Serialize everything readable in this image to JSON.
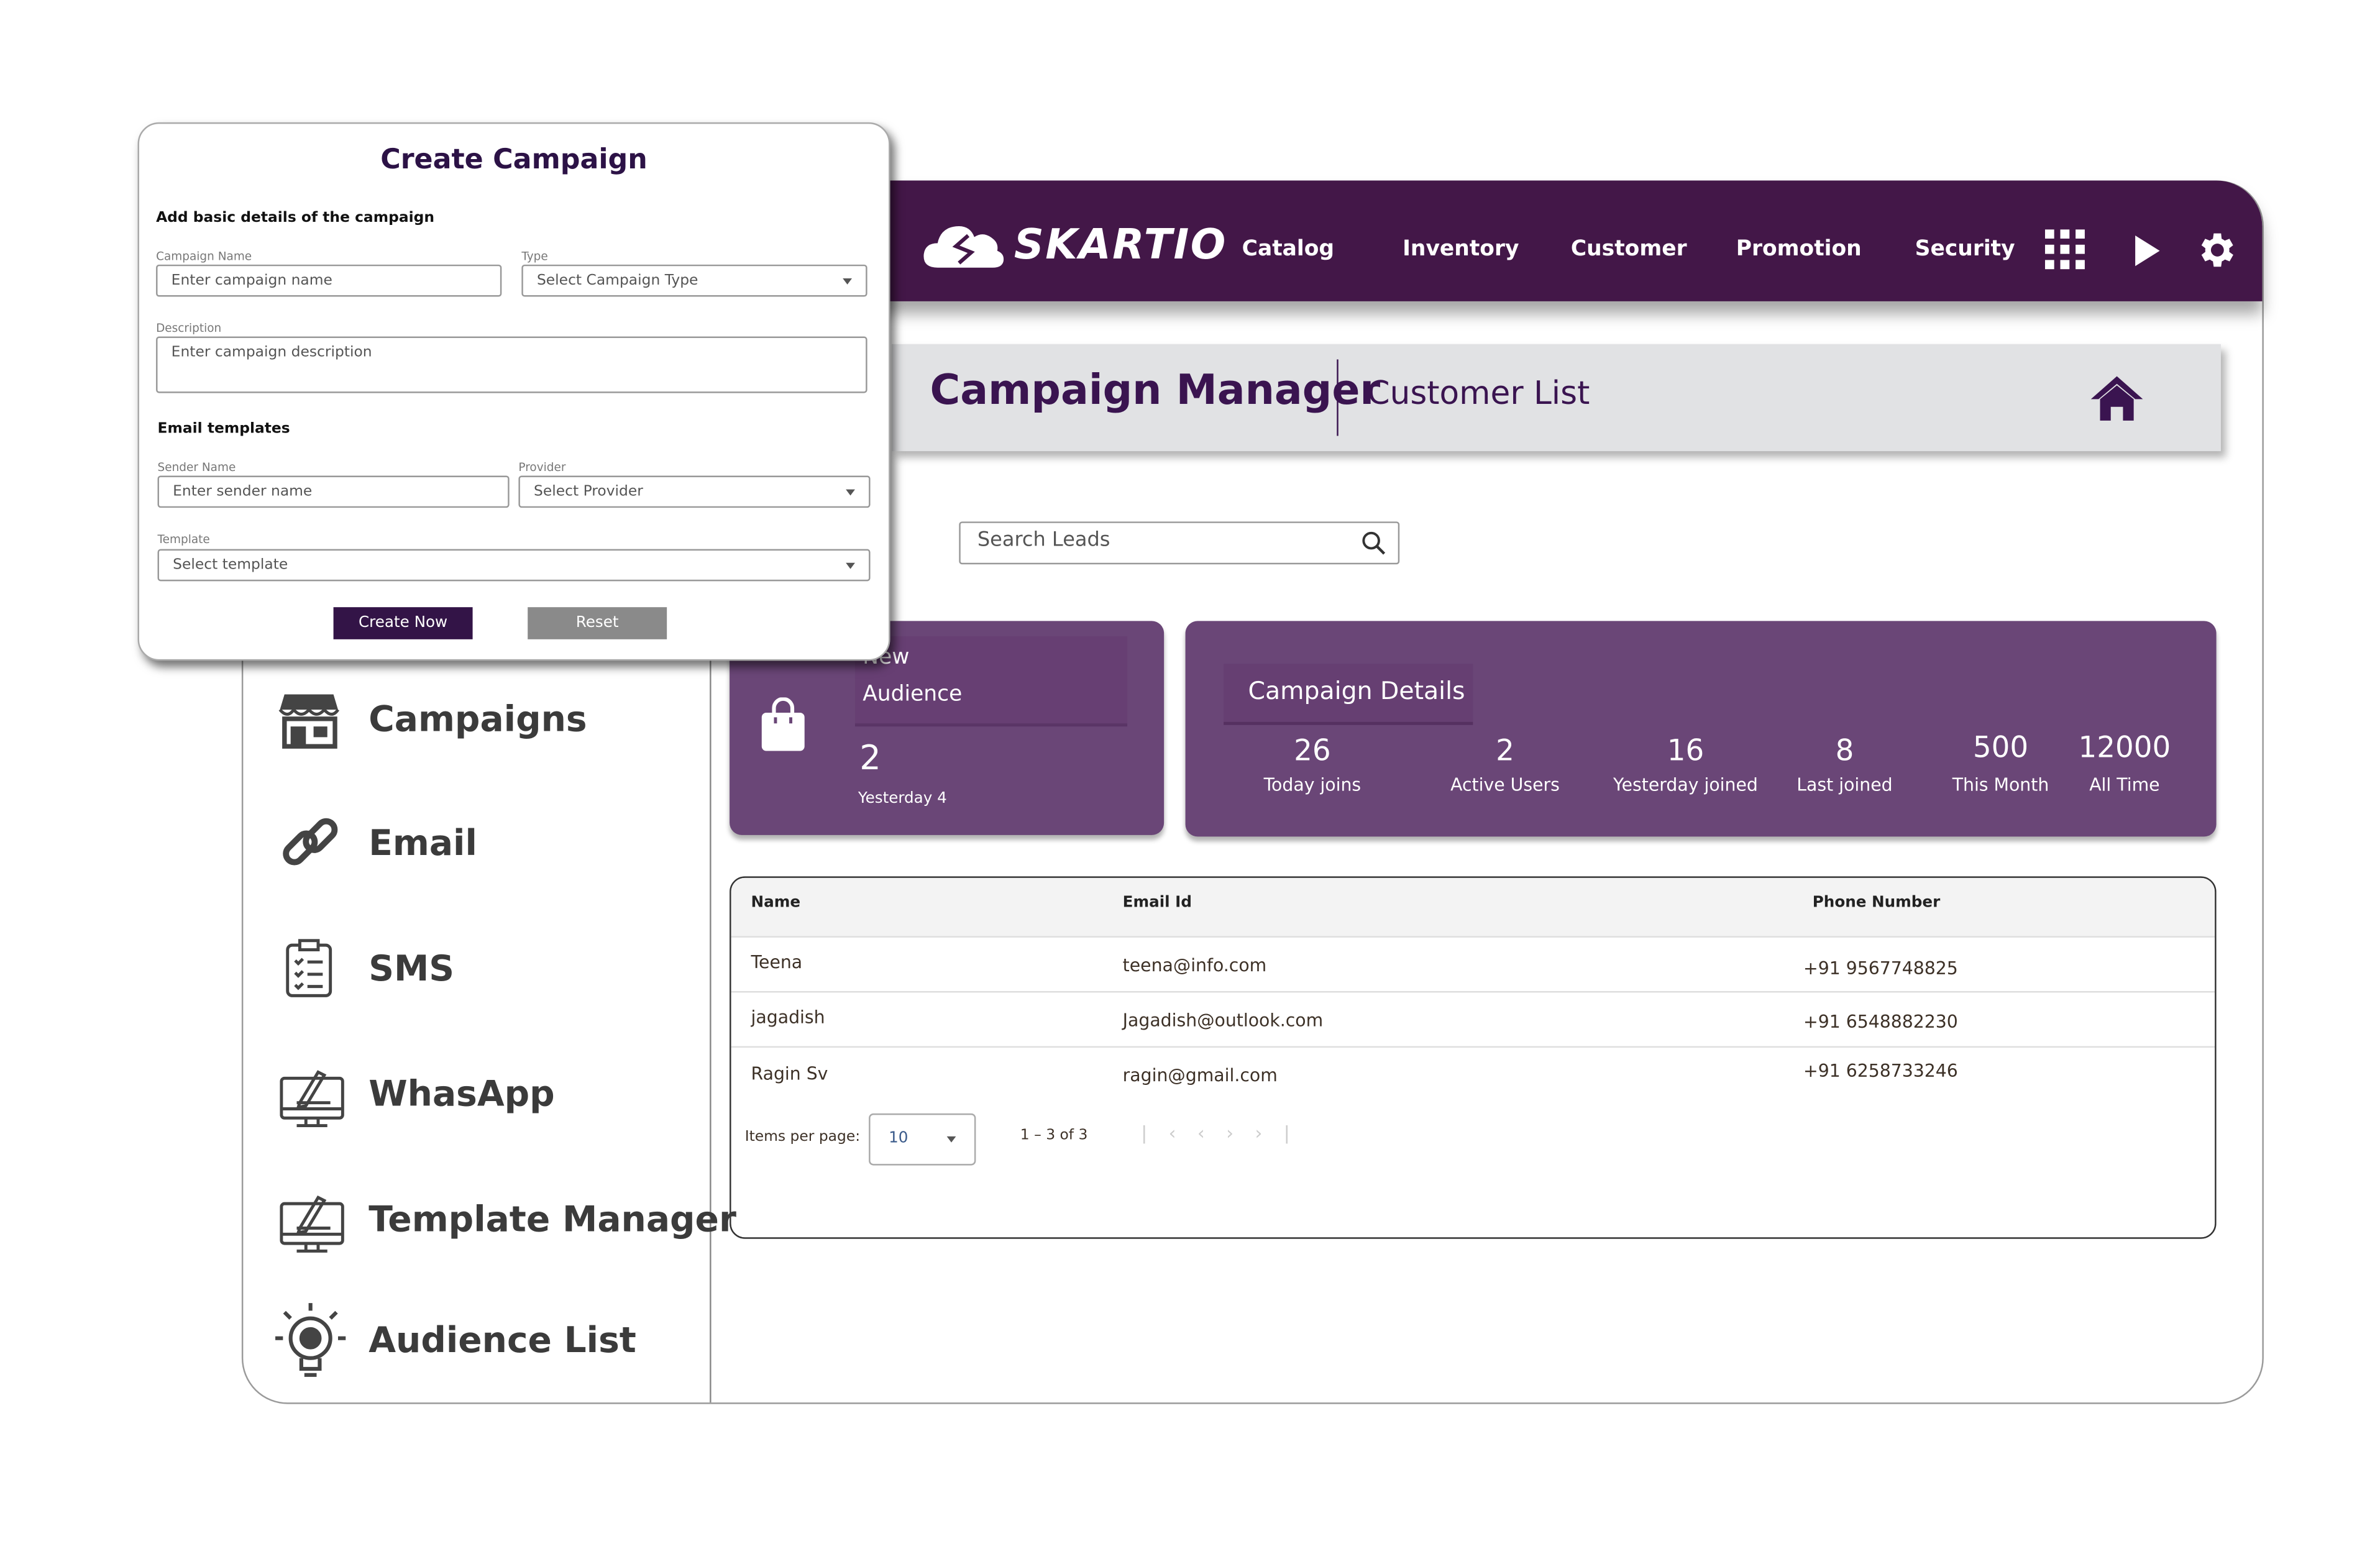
{
  "brand": {
    "name": "SKARTIO",
    "color": "#431748"
  },
  "nav": {
    "items": [
      "Catalog",
      "Inventory",
      "Customer",
      "Promotion",
      "Security"
    ],
    "icons": [
      "apps-grid-icon",
      "play-icon",
      "gear-icon"
    ]
  },
  "header": {
    "title": "Campaign Manager",
    "subtitle": "Customer List"
  },
  "search": {
    "placeholder": "Search Leads"
  },
  "audience_card": {
    "title_line1": "New",
    "title_line2": "Audience",
    "value": "2",
    "sub": "Yesterday 4"
  },
  "campaign_details": {
    "title": "Campaign Details",
    "stats": [
      {
        "value": "26",
        "label": "Today joins"
      },
      {
        "value": "2",
        "label": "Active Users"
      },
      {
        "value": "16",
        "label": "Yesterday joined"
      },
      {
        "value": "8",
        "label": "Last joined"
      },
      {
        "value": "500",
        "label": "This Month"
      },
      {
        "value": "12000",
        "label": "All Time"
      }
    ]
  },
  "table": {
    "columns": [
      "Name",
      "Email Id",
      "Phone Number"
    ],
    "rows": [
      {
        "name": "Teena",
        "email": "teena@info.com",
        "phone": "+91 9567748825"
      },
      {
        "name": "jagadish",
        "email": "Jagadish@outlook.com",
        "phone": "+91 6548882230"
      },
      {
        "name": "Ragin Sv",
        "email": "ragin@gmail.com",
        "phone": "+91 6258733246"
      }
    ],
    "items_per_page_label": "Items per page:",
    "items_per_page": "10",
    "range": "1 – 3 of 3"
  },
  "sidebar": {
    "items": [
      {
        "label": "Campaigns",
        "icon": "store-icon"
      },
      {
        "label": "Email",
        "icon": "link-icon"
      },
      {
        "label": "SMS",
        "icon": "clipboard-list-icon"
      },
      {
        "label": "WhasApp",
        "icon": "monitor-edit-icon"
      },
      {
        "label": "Template Manager",
        "icon": "monitor-edit-icon"
      },
      {
        "label": "Audience List",
        "icon": "lightbulb-gear-icon"
      }
    ]
  },
  "modal": {
    "title": "Create Campaign",
    "section1": "Add basic details of the campaign",
    "campaign_name_label": "Campaign Name",
    "campaign_name_placeholder": "Enter campaign name",
    "type_label": "Type",
    "type_placeholder": "Select Campaign Type",
    "description_label": "Description",
    "description_placeholder": "Enter campaign description",
    "section2": "Email templates",
    "sender_label": "Sender Name",
    "sender_placeholder": "Enter sender name",
    "provider_label": "Provider",
    "provider_placeholder": "Select Provider",
    "template_label": "Template",
    "template_placeholder": "Select template",
    "create_label": "Create Now",
    "reset_label": "Reset"
  },
  "colors": {
    "primary": "#431748",
    "card": "#6a4677",
    "button_primary": "#331447",
    "button_reset": "#8a8a8a"
  }
}
